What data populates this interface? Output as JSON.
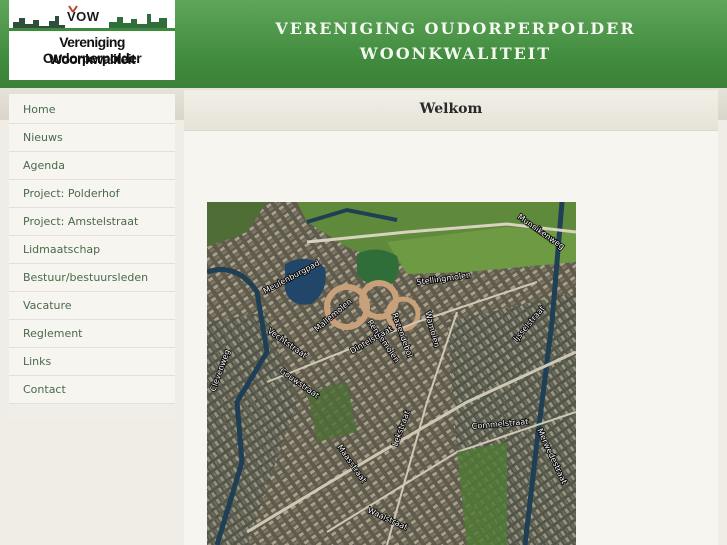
{
  "logo": {
    "abbreviation": "VOW",
    "line1": "Vereniging Oudorperpolder",
    "line2": "Woonkwaliteit"
  },
  "header": {
    "title_line1": "VERENIGING OUDORPERPOLDER",
    "title_line2": "WOONKWALITEIT"
  },
  "colors": {
    "header_green": "#3f8a3d",
    "nav_text": "#4b6a4a",
    "background": "#efede6"
  },
  "sidebar": {
    "items": [
      {
        "label": "Home"
      },
      {
        "label": "Nieuws"
      },
      {
        "label": "Agenda"
      },
      {
        "label": "Project: Polderhof"
      },
      {
        "label": "Project: Amstelstraat"
      },
      {
        "label": "Lidmaatschap"
      },
      {
        "label": "Bestuur/bestuursleden"
      },
      {
        "label": "Vacature"
      },
      {
        "label": "Reglement"
      },
      {
        "label": "Links"
      },
      {
        "label": "Contact"
      }
    ]
  },
  "main": {
    "title": "Welkom"
  },
  "map": {
    "streets": [
      {
        "name": "Munnikenweg"
      },
      {
        "name": "Stellingmolen"
      },
      {
        "name": "Meulenburgpad"
      },
      {
        "name": "Mallemolen"
      },
      {
        "name": "Razendebol"
      },
      {
        "name": "Rennemolen"
      },
      {
        "name": "Dintelstraat"
      },
      {
        "name": "Wamolen"
      },
      {
        "name": "Ijsselstraat"
      },
      {
        "name": "Gouwstraat"
      },
      {
        "name": "Commelstraat"
      },
      {
        "name": "Vechtstraat"
      },
      {
        "name": "Clevenweg"
      },
      {
        "name": "Maasstraat"
      },
      {
        "name": "Waalstraat"
      },
      {
        "name": "Merwedestraat"
      },
      {
        "name": "Lekstraat"
      }
    ]
  }
}
